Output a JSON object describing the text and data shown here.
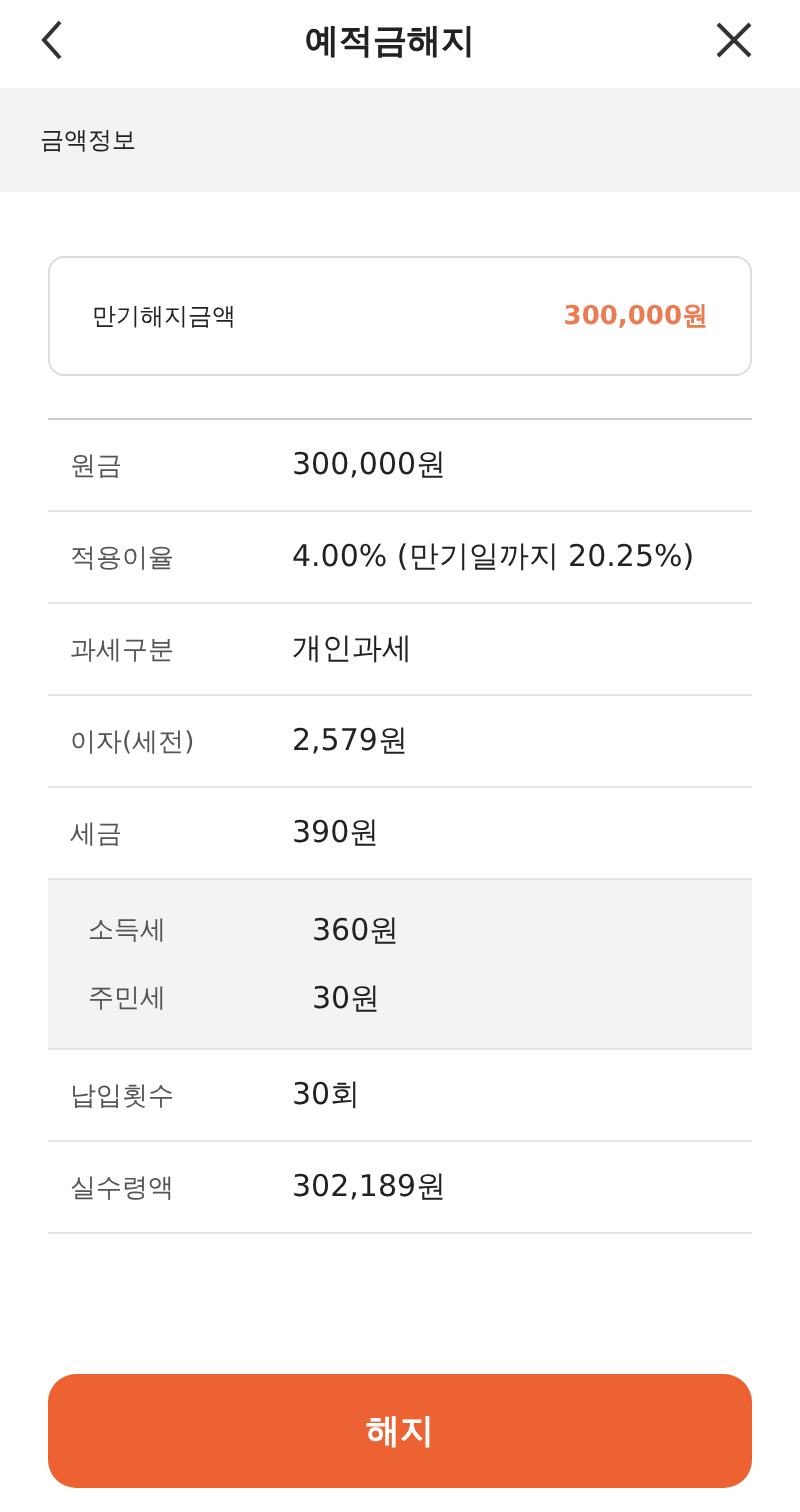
{
  "header": {
    "title": "예적금해지"
  },
  "section": {
    "title": "금액정보"
  },
  "summary": {
    "label": "만기해지금액",
    "amount": "300,000원"
  },
  "items": [
    {
      "kind": "row",
      "label": "원금",
      "value": "300,000원"
    },
    {
      "kind": "row",
      "label": "적용이율",
      "value": "4.00% (만기일까지 20.25%)"
    },
    {
      "kind": "row",
      "label": "과세구분",
      "value": "개인과세"
    },
    {
      "kind": "row",
      "label": "이자(세전)",
      "value": "2,579원"
    },
    {
      "kind": "row",
      "label": "세금",
      "value": "390원"
    },
    {
      "kind": "breakdown",
      "entries": [
        {
          "label": "소득세",
          "value": "360원"
        },
        {
          "label": "주민세",
          "value": "30원"
        }
      ]
    },
    {
      "kind": "row",
      "label": "납입횟수",
      "value": "30회"
    },
    {
      "kind": "row",
      "label": "실수령액",
      "value": "302,189원"
    }
  ],
  "action": {
    "label": "해지"
  }
}
